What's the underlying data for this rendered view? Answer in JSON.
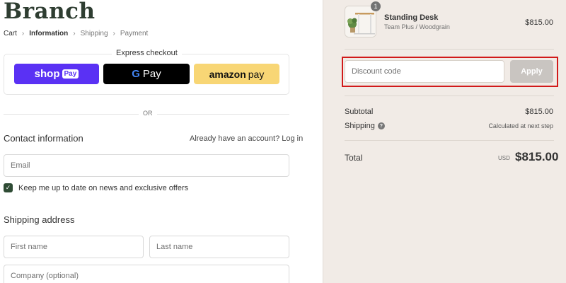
{
  "brand": {
    "logo": "Branch"
  },
  "breadcrumb": [
    "Cart",
    "Information",
    "Shipping",
    "Payment"
  ],
  "express": {
    "title": "Express checkout",
    "shop_label": "shop",
    "shop_badge": "Pay",
    "gpay_g": "G",
    "gpay_label": "Pay",
    "amazon_a": "amazon",
    "amazon_label": "pay"
  },
  "divider": {
    "or": "OR"
  },
  "contact": {
    "title": "Contact information",
    "login_prompt": "Already have an account?",
    "login_link": "Log in",
    "email_placeholder": "Email",
    "newsletter_label": "Keep me up to date on news and exclusive offers"
  },
  "shipping": {
    "title": "Shipping address",
    "first_name_placeholder": "First name",
    "last_name_placeholder": "Last name",
    "company_placeholder": "Company (optional)"
  },
  "cart": {
    "item": {
      "quantity": "1",
      "name": "Standing Desk",
      "variant": "Team Plus / Woodgrain",
      "price": "$815.00"
    },
    "discount_placeholder": "Discount code",
    "apply_label": "Apply",
    "subtotal_label": "Subtotal",
    "subtotal_value": "$815.00",
    "shipping_label": "Shipping",
    "shipping_value": "Calculated at next step",
    "total_label": "Total",
    "currency": "USD",
    "total_value": "$815.00"
  },
  "colors": {
    "accent": "#2e4b34",
    "highlight": "#d11a1a",
    "shop_pay": "#5a31f4",
    "amazon_pay": "#f8d675"
  }
}
